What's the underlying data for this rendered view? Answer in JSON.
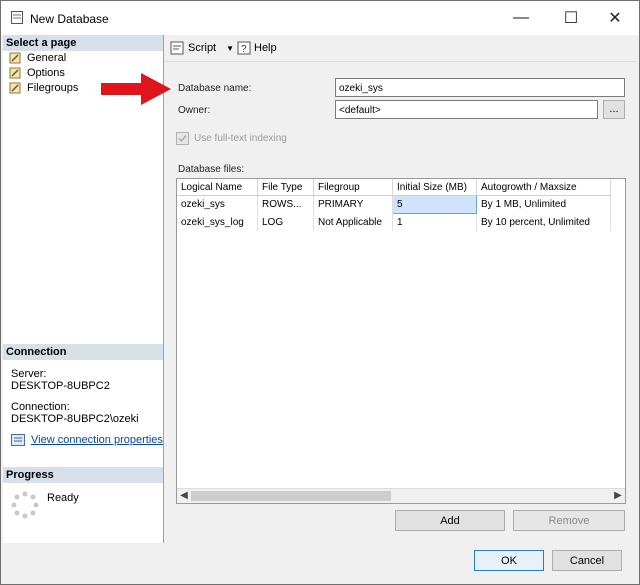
{
  "window": {
    "title": "New Database"
  },
  "titlebar": {
    "minimize_label": "—",
    "maximize_label": "☐",
    "close_label": "✕"
  },
  "sidebar": {
    "select_page_header": "Select a page",
    "pages": [
      {
        "label": "General",
        "icon": "wrench-icon"
      },
      {
        "label": "Options",
        "icon": "wrench-icon"
      },
      {
        "label": "Filegroups",
        "icon": "wrench-icon"
      }
    ],
    "connection_header": "Connection",
    "server_label": "Server:",
    "server_value": "DESKTOP-8UBPC2",
    "connection_label": "Connection:",
    "connection_value": "DESKTOP-8UBPC2\\ozeki",
    "view_connection_link": "View connection properties",
    "progress_header": "Progress",
    "progress_status": "Ready"
  },
  "toolbar": {
    "script_label": "Script",
    "help_label": "Help"
  },
  "form": {
    "database_name_label": "Database name:",
    "database_name_value": "ozeki_sys",
    "owner_label": "Owner:",
    "owner_value": "<default>",
    "browse_label": "...",
    "fulltext_label": "Use full-text indexing",
    "database_files_label": "Database files:"
  },
  "files_table": {
    "columns": [
      "Logical Name",
      "File Type",
      "Filegroup",
      "Initial Size (MB)",
      "Autogrowth / Maxsize"
    ],
    "rows": [
      [
        "ozeki_sys",
        "ROWS...",
        "PRIMARY",
        "5",
        "By 1 MB, Unlimited"
      ],
      [
        "ozeki_sys_log",
        "LOG",
        "Not Applicable",
        "1",
        "By 10 percent, Unlimited"
      ]
    ]
  },
  "buttons": {
    "add": "Add",
    "remove": "Remove",
    "ok": "OK",
    "cancel": "Cancel"
  },
  "colors": {
    "arrow": "#e0141b",
    "header_bg": "#d7dfe9",
    "selected_cell": "#cfe3fb"
  }
}
